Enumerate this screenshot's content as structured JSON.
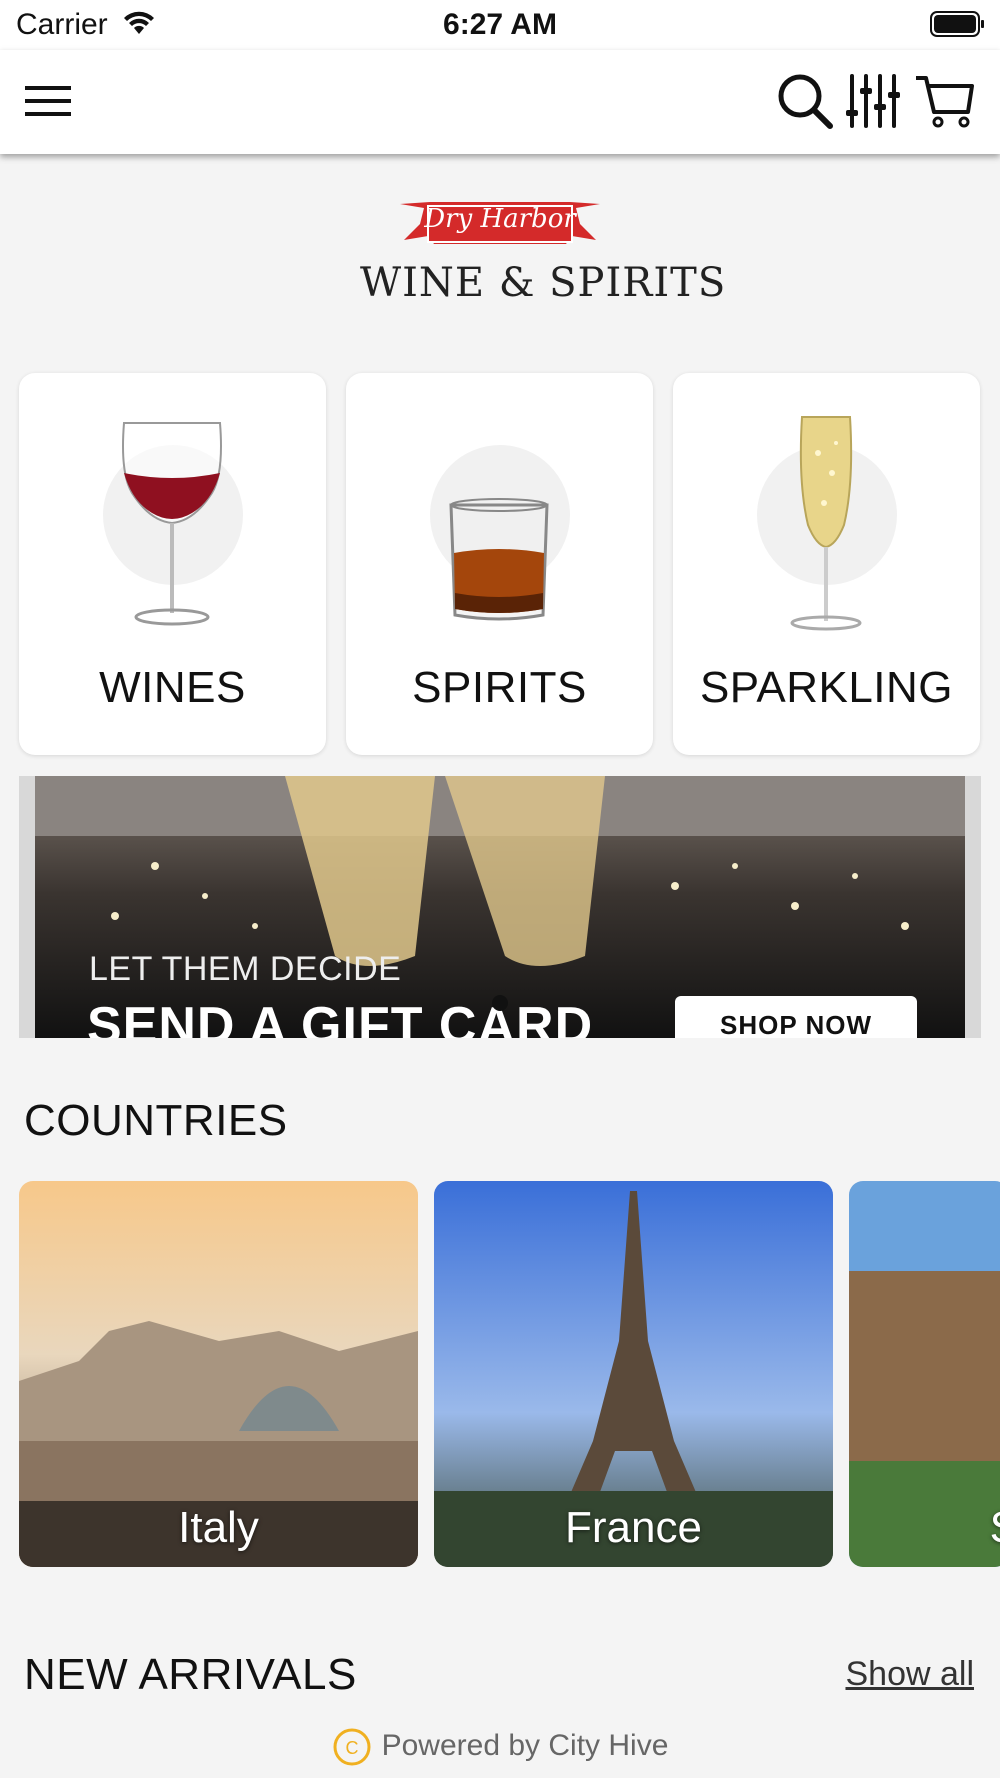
{
  "status_bar": {
    "carrier": "Carrier",
    "time": "6:27 AM"
  },
  "nav": {
    "icons": [
      "menu-icon",
      "search-icon",
      "filter-icon",
      "cart-icon"
    ]
  },
  "logo": {
    "ribbon_text": "Dry Harbor",
    "wordmark": "WINE & SPIRITS"
  },
  "categories": [
    {
      "label": "WINES",
      "icon": "wine-glass-icon"
    },
    {
      "label": "SPIRITS",
      "icon": "whiskey-glass-icon"
    },
    {
      "label": "SPARKLING",
      "icon": "champagne-flute-icon"
    }
  ],
  "banner": {
    "subtitle": "LET THEM DECIDE",
    "title": "SEND A GIFT CARD",
    "cta": "SHOP NOW"
  },
  "countries_section": {
    "title": "COUNTRIES",
    "items": [
      "Italy",
      "France",
      "S"
    ]
  },
  "new_arrivals": {
    "title": "NEW ARRIVALS",
    "show_all": "Show all"
  },
  "footer": {
    "powered_by": "Powered by City Hive"
  },
  "colors": {
    "brand_red": "#d42a2a",
    "background": "#f4f4f4"
  }
}
